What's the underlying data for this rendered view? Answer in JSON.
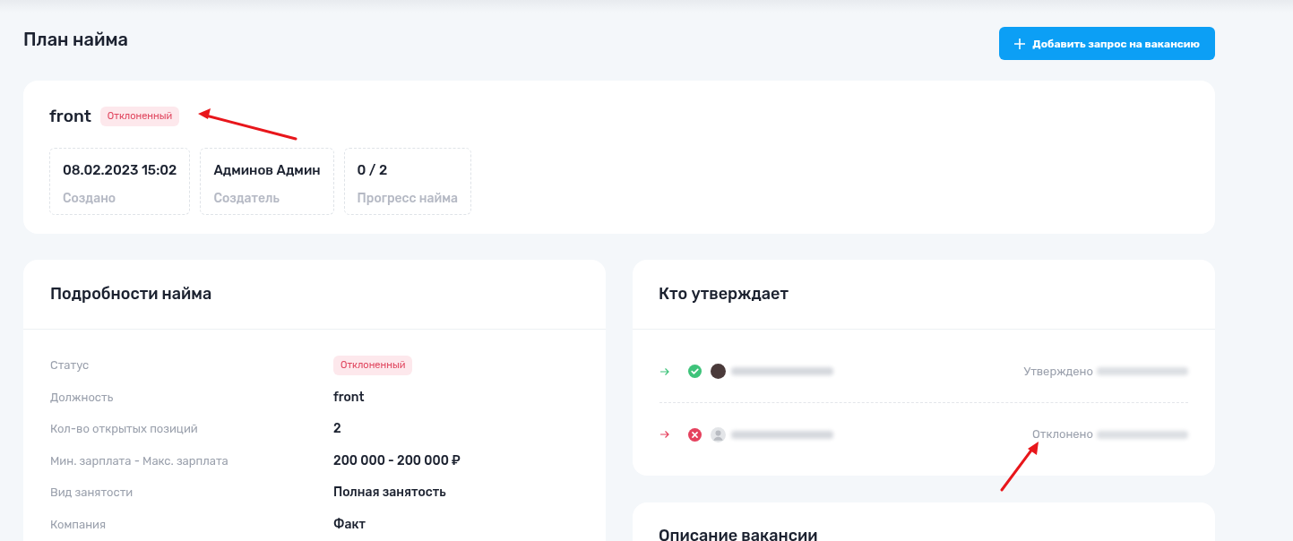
{
  "page": {
    "title": "План найма",
    "add_button": "Добавить запрос на вакансию"
  },
  "summary": {
    "title": "front",
    "status": {
      "text": "Отклоненный",
      "kind": "rejected"
    },
    "stats": [
      {
        "value": "08.02.2023 15:02",
        "label": "Создано"
      },
      {
        "value": "Админов Админ",
        "label": "Создатель"
      },
      {
        "value": "0 / 2",
        "label": "Прогресс найма"
      }
    ]
  },
  "details": {
    "title": "Подробности найма",
    "rows": [
      {
        "label": "Статус",
        "kind": "badge",
        "badge": {
          "text": "Отклоненный",
          "kind": "rejected"
        }
      },
      {
        "label": "Должность",
        "kind": "text",
        "value": "front"
      },
      {
        "label": "Кол-во открытых позиций",
        "kind": "text",
        "value": "2"
      },
      {
        "label": "Мин. зарплата - Макс. зарплата",
        "kind": "text",
        "value": "200 000 - 200 000 ₽"
      },
      {
        "label": "Вид занятости",
        "kind": "text",
        "value": "Полная занятость"
      },
      {
        "label": "Компания",
        "kind": "text",
        "value": "Факт"
      }
    ]
  },
  "approvers": {
    "title": "Кто утверждает",
    "items": [
      {
        "kind": "approved",
        "avatar": {
          "kind": "photo"
        },
        "status_text": "Утверждено"
      },
      {
        "kind": "rejected",
        "avatar": {
          "kind": "silhouette"
        },
        "status_text": "Отклонено"
      }
    ]
  },
  "description": {
    "title": "Описание вакансии"
  }
}
